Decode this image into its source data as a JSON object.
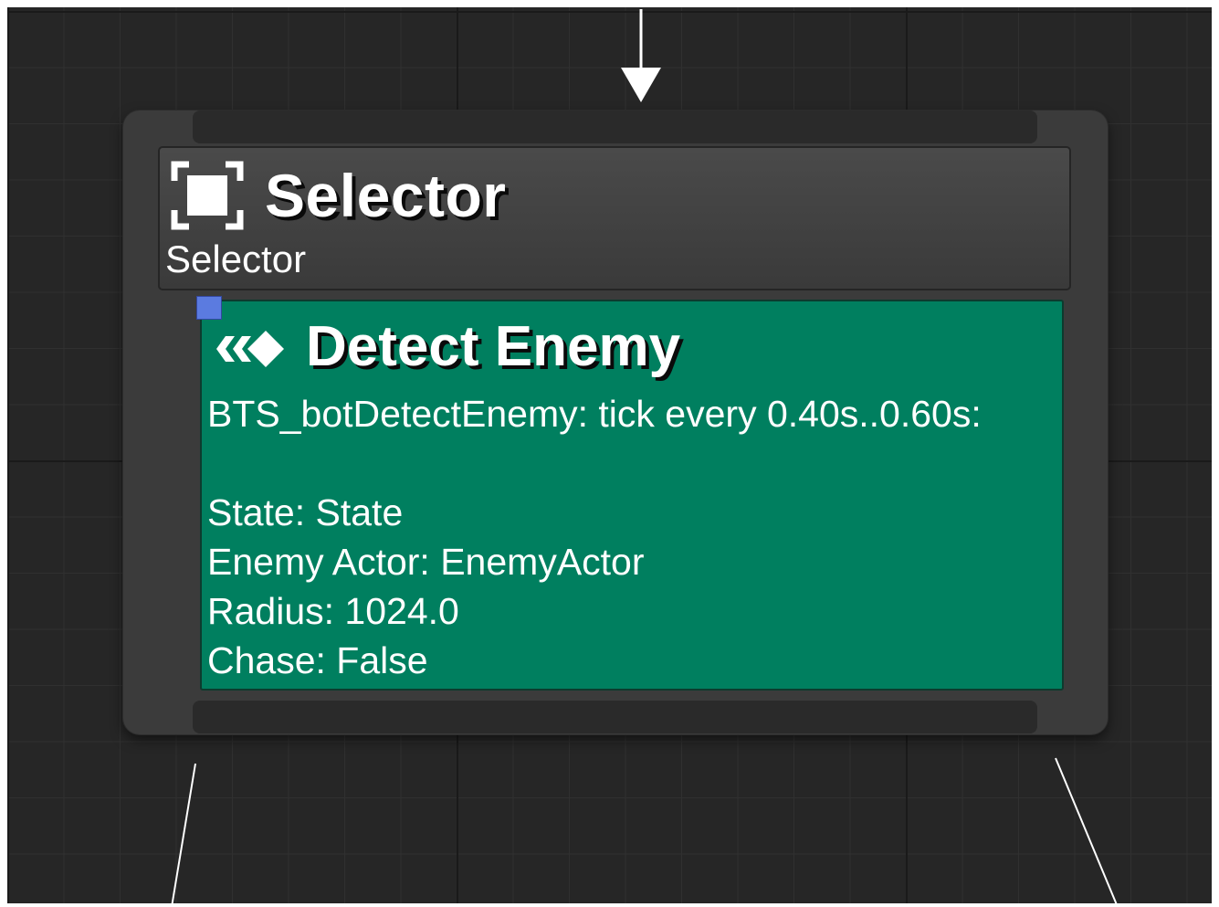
{
  "composite_node": {
    "title": "Selector",
    "subtitle": "Selector",
    "icon": "selector-icon"
  },
  "service_node": {
    "title": "Detect Enemy",
    "icon": "service-icon",
    "description_lines": [
      "BTS_botDetectEnemy: tick every 0.40s..0.60s:",
      "",
      "State: State",
      "Enemy Actor: EnemyActor",
      "Radius: 1024.0",
      "Chase: False"
    ]
  },
  "colors": {
    "graph_background": "#262626",
    "node_body": "#3b3b3b",
    "service_fill": "#007f5f",
    "breakpoint": "#5b7be0",
    "wire": "#ffffff"
  }
}
